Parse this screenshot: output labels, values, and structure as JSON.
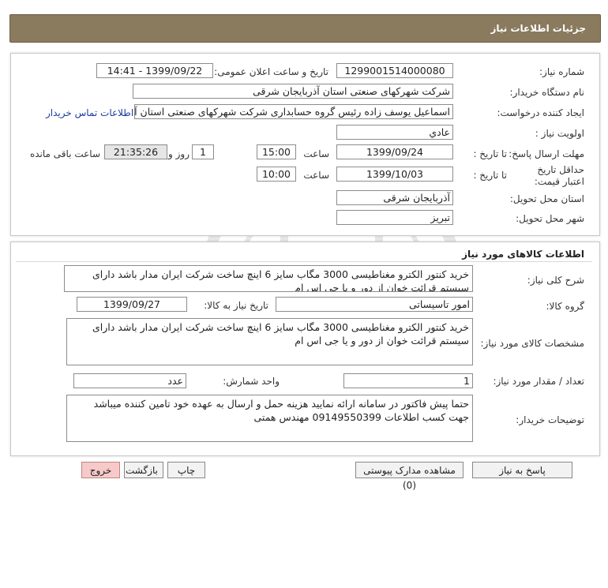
{
  "header": {
    "title": "جزئیات اطلاعات نیاز"
  },
  "info": {
    "need_number_label": "شماره نیاز:",
    "need_number": "1299001514000080",
    "announce_label": "تاریخ و ساعت اعلان عمومی:",
    "announce_value": "1399/09/22 - 14:41",
    "buyer_label": "نام دستگاه خریدار:",
    "buyer_value": "شرکت شهرکهای صنعتی استان آذربایجان شرقی",
    "requester_label": "ایجاد کننده درخواست:",
    "requester_value": "اسماعیل یوسف زاده رئیس گروه حسابداری شرکت شهرکهای صنعتی استان آذربایجان شرقی",
    "contact_link": "اطلاعات تماس خریدار",
    "priority_label": "اولویت نیاز :",
    "priority_value": "عادي",
    "deadline_label": "مهلت ارسال پاسخ:",
    "to_date_label": "تا تاریخ :",
    "deadline_date": "1399/09/24",
    "time_label": "ساعت",
    "deadline_time": "15:00",
    "days_value": "1",
    "days_label": "روز و",
    "remaining_value": "21:35:26",
    "remaining_label": "ساعت باقی مانده",
    "validity_label": "حداقل تاریخ اعتبار قیمت:",
    "validity_date": "1399/10/03",
    "validity_time": "10:00",
    "province_label": "استان محل تحویل:",
    "province_value": "آذربایجان شرقی",
    "city_label": "شهر محل تحویل:",
    "city_value": "تبریز"
  },
  "goods": {
    "section_title": "اطلاعات کالاهای مورد نیاز",
    "summary_label": "شرح کلی نیاز:",
    "summary_value": "خرید کنتور الکترو مغناطیسی 3000 مگاب سایز 6 اینچ ساخت شرکت ایران مدار باشد دارای سیستم قرائت خوان از دور و یا جی اس ام",
    "group_label": "گروه کالا:",
    "group_value": "امور تاسیساتی",
    "need_date_label": "تاریخ نیاز به کالا:",
    "need_date_value": "1399/09/27",
    "specs_label": "مشخصات کالای مورد نیاز:",
    "specs_value": "خرید کنتور الکترو مغناطیسی 3000 مگاب سایز 6 اینچ ساخت شرکت ایران مدار باشد دارای سیستم قرائت خوان از دور و یا جی اس ام",
    "qty_label": "تعداد / مقدار مورد نیاز:",
    "qty_value": "1",
    "unit_label": "واحد شمارش:",
    "unit_value": "عدد",
    "notes_label": "توضیحات خریدار:",
    "notes_value": "حتما پیش فاکتور در سامانه ارائه نمایید هزینه حمل و ارسال به عهده خود تامین کننده میباشد جهت کسب اطلاعات 09149550399 مهندس همتی"
  },
  "buttons": {
    "reply": "پاسخ به نیاز",
    "attachments": "مشاهده مدارک پیوستی (0)",
    "print": "چاپ",
    "back": "بازگشت",
    "exit": "خروج"
  }
}
